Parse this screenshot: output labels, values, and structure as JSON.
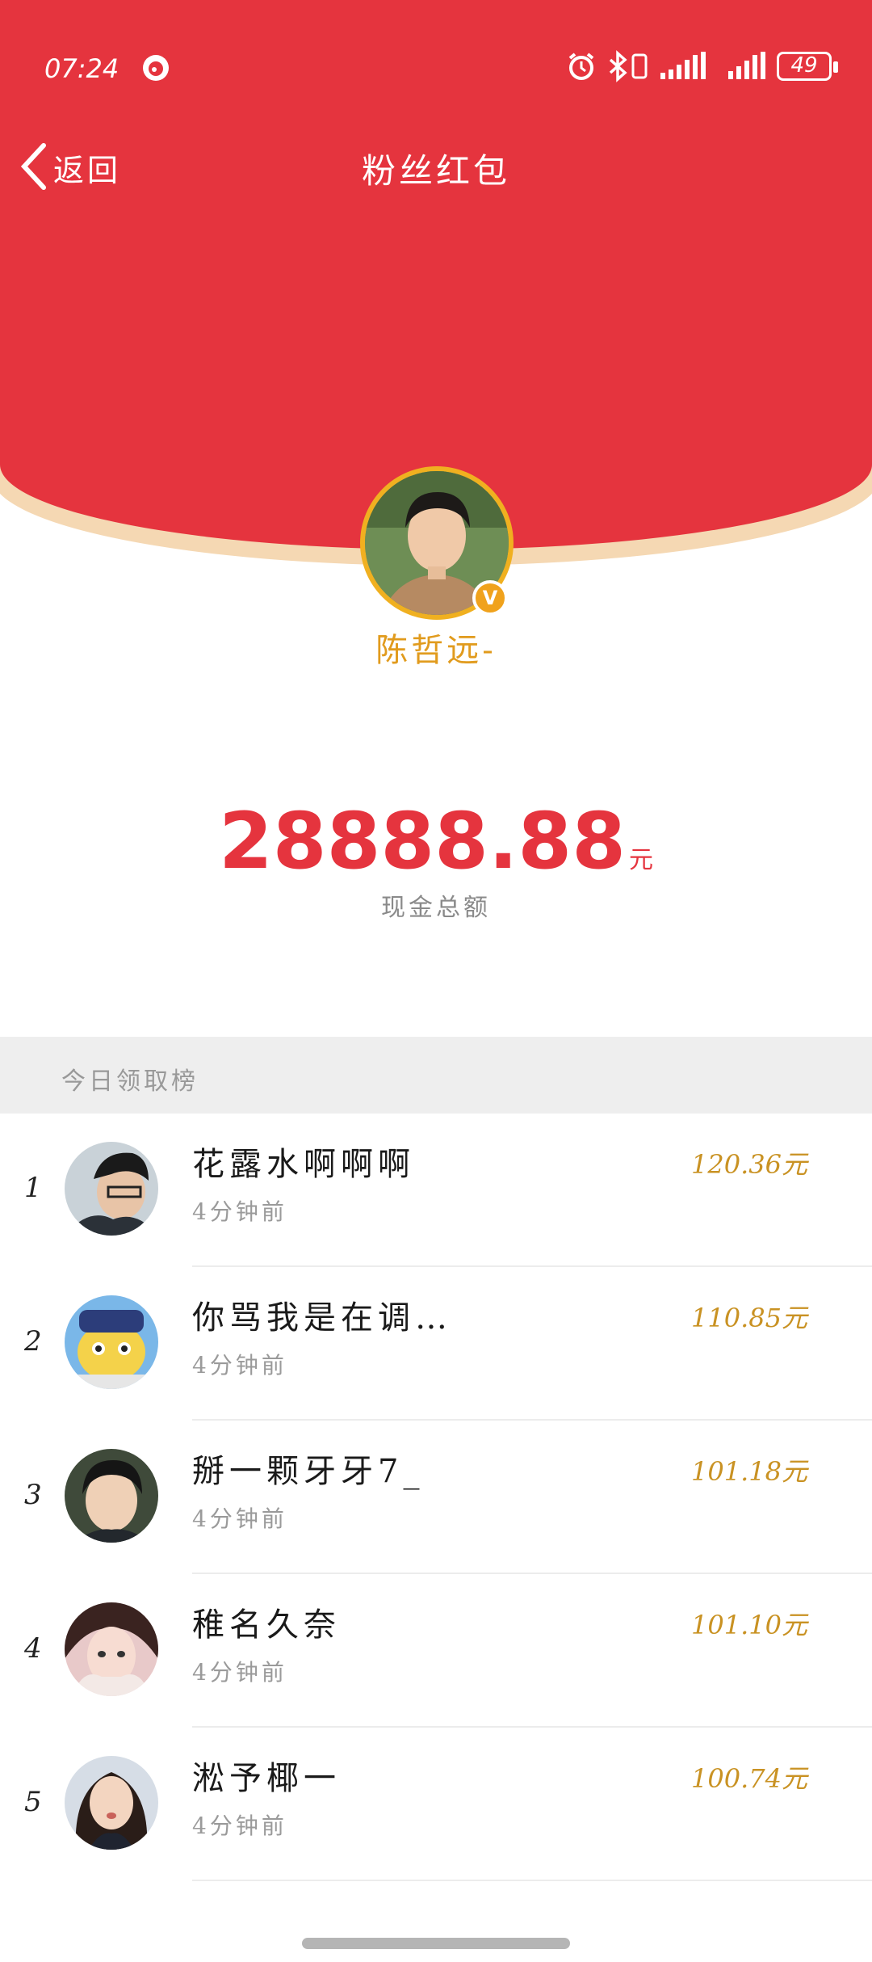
{
  "status_bar": {
    "time": "07:24",
    "battery": "49"
  },
  "nav": {
    "back_label": "返回",
    "title": "粉丝红包"
  },
  "host": {
    "name": "陈哲远-",
    "verified_badge": "V"
  },
  "total": {
    "amount": "28888.88",
    "unit": "元",
    "label": "现金总额"
  },
  "leaderboard": {
    "title": "今日领取榜",
    "rows": [
      {
        "rank": "1",
        "name": "花露水啊啊啊",
        "time": "4分钟前",
        "amount": "120.36元"
      },
      {
        "rank": "2",
        "name": "你骂我是在调…",
        "time": "4分钟前",
        "amount": "110.85元"
      },
      {
        "rank": "3",
        "name": "掰一颗牙牙7_",
        "time": "4分钟前",
        "amount": "101.18元"
      },
      {
        "rank": "4",
        "name": "稚名久奈",
        "time": "4分钟前",
        "amount": "101.10元"
      },
      {
        "rank": "5",
        "name": "淞予椰一",
        "time": "4分钟前",
        "amount": "100.74元"
      }
    ]
  },
  "colors": {
    "header_red": "#e5343e",
    "gold": "#e19b1d",
    "amount_red": "#e5343e"
  },
  "icons": [
    "weibo-icon",
    "alarm-icon",
    "bluetooth-icon",
    "vibrate-icon",
    "signal-icon",
    "battery-icon",
    "back-chevron-icon",
    "verified-icon"
  ]
}
